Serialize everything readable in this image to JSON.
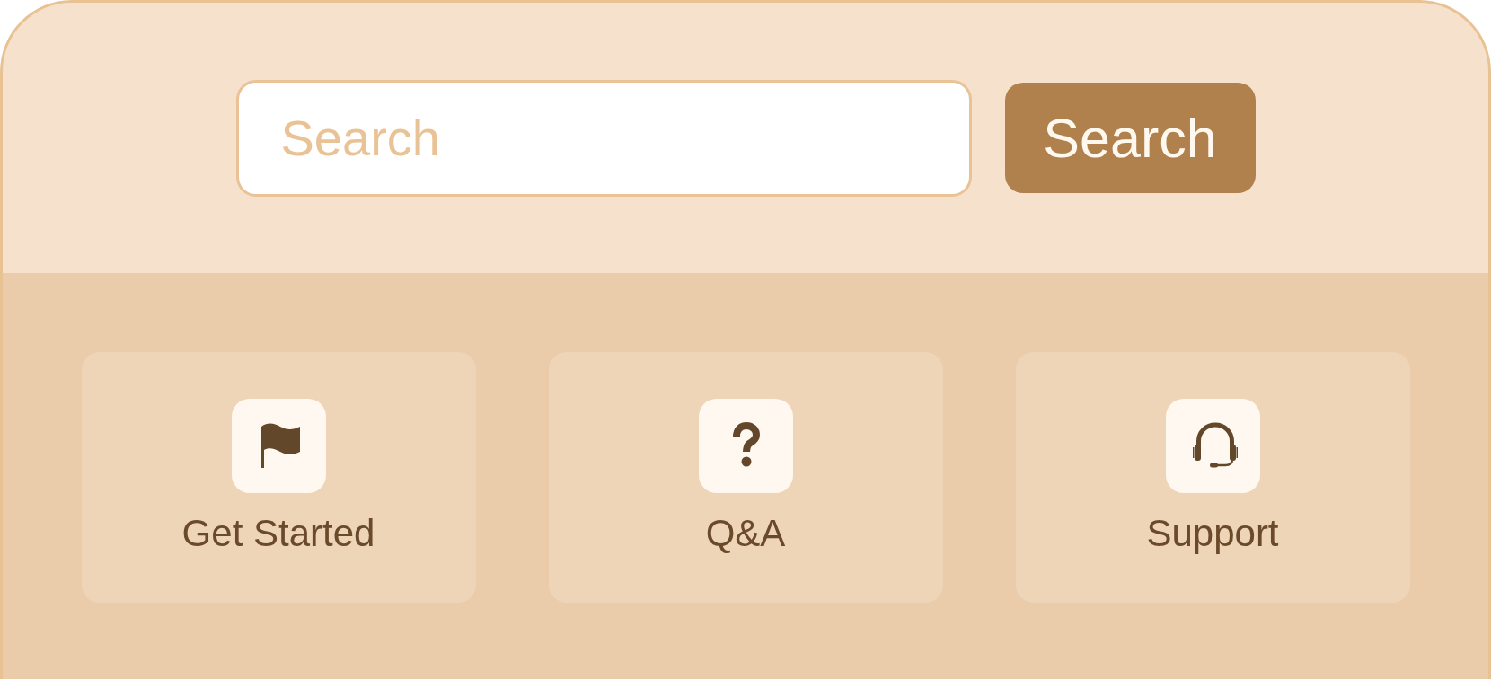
{
  "search": {
    "placeholder": "Search",
    "button": "Search"
  },
  "cards": [
    {
      "kind": "flag",
      "label": "Get Started"
    },
    {
      "kind": "question",
      "label": "Q&A"
    },
    {
      "kind": "headset",
      "label": "Support"
    }
  ]
}
